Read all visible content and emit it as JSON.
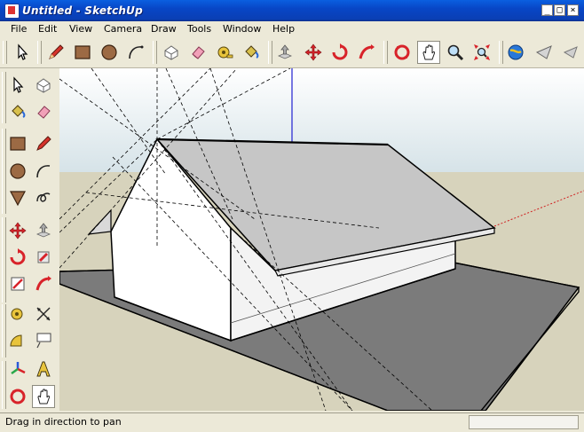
{
  "window": {
    "title": "Untitled - SketchUp",
    "minimize_glyph": "_",
    "maximize_glyph": "□",
    "close_glyph": "×"
  },
  "menu": [
    "File",
    "Edit",
    "View",
    "Camera",
    "Draw",
    "Tools",
    "Window",
    "Help"
  ],
  "toolbar": {
    "icons": [
      "select-icon",
      "pencil-icon",
      "rectangle-icon",
      "circle-icon",
      "arc-icon",
      "make-component-icon",
      "eraser-icon",
      "tape-measure-icon",
      "paint-bucket-icon",
      "push-pull-icon",
      "move-icon",
      "rotate-icon",
      "follow-me-icon",
      "orbit-icon",
      "pan-icon",
      "zoom-icon",
      "zoom-extents-icon",
      "get-models-icon",
      "share-model-icon"
    ],
    "active_tool": "pan-icon"
  },
  "left_toolbar": {
    "icons": [
      "select-icon",
      "component-icon",
      "paint-bucket-icon",
      "eraser-icon",
      "rectangle-icon",
      "line-icon",
      "circle-icon",
      "arc-icon",
      "polygon-icon",
      "freehand-icon",
      "move-icon",
      "push-pull-icon",
      "rotate-icon",
      "follow-me-icon",
      "scale-icon",
      "offset-icon",
      "tape-measure-icon",
      "dimension-icon",
      "protractor-icon",
      "text-icon",
      "axes-icon",
      "3d-text-icon",
      "orbit-icon",
      "pan-icon"
    ]
  },
  "status": {
    "text": "Drag in direction to pan",
    "measurement_value": ""
  },
  "colors": {
    "title_bar": "#0a4fd6",
    "chrome": "#ece9d8",
    "sky": "#eef3f4",
    "ground": "#d7d3bc",
    "ground_plane": "#7b7b7b",
    "roof": "#c6c6c6",
    "wall": "#ffffff",
    "axis_blue": "#2020d0",
    "axis_red": "#d02020"
  }
}
